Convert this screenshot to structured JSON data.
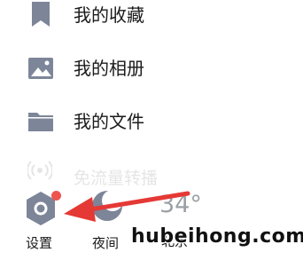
{
  "menu": {
    "favorites": {
      "label": "我的收藏",
      "icon": "bookmark-icon"
    },
    "album": {
      "label": "我的相册",
      "icon": "image-icon"
    },
    "files": {
      "label": "我的文件",
      "icon": "folder-icon"
    },
    "faded": {
      "label": "免流量转播",
      "icon": "broadcast-icon"
    }
  },
  "bottom": {
    "settings_label": "设置",
    "settings_icon": "settings-hex-icon",
    "settings_badge": true,
    "night_label": "夜间",
    "night_icon": "moon-icon",
    "temperature": "34°",
    "weather_label": "北京"
  },
  "annotation": {
    "arrow_color": "#e53935",
    "arrow_icon": "red-arrow-pointer"
  },
  "watermark": "hubeihong.com",
  "colors": {
    "icon_gray": "#7d8599",
    "badge_red": "#ef5350"
  }
}
